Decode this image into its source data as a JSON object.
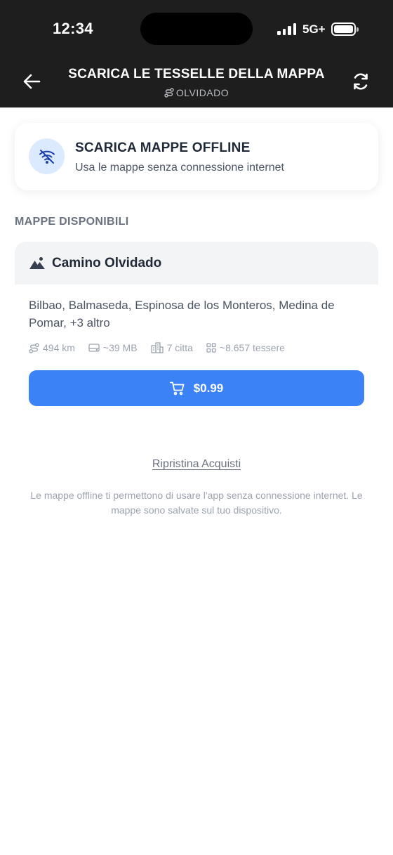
{
  "status_bar": {
    "time": "12:34",
    "network": "5G+",
    "battery_icon": "battery-full-icon",
    "signal_icon": "cellular-signal-icon"
  },
  "header": {
    "title": "SCARICA LE TESSELLE DELLA MAPPA",
    "subtitle": "OLVIDADO",
    "subtitle_icon": "route-icon",
    "back_icon": "arrow-left-icon",
    "refresh_icon": "refresh-icon",
    "background": "#1e1e1e"
  },
  "info_card": {
    "icon": "wifi-off-icon",
    "title": "SCARICA MAPPE OFFLINE",
    "subtitle": "Usa le mappe senza connessione internet"
  },
  "section": {
    "label": "MAPPE DISPONIBILI"
  },
  "map_card": {
    "icon": "mountain-icon",
    "name": "Camino Olvidado",
    "cities": "Bilbao, Balmaseda, Espinosa de los Monteros, Medina de Pomar, +3 altro",
    "stats": [
      {
        "icon": "route-icon",
        "value": "494 km"
      },
      {
        "icon": "storage-icon",
        "value": "~39 MB"
      },
      {
        "icon": "buildings-icon",
        "value": "7 citta"
      },
      {
        "icon": "grid-icon",
        "value": "~8.657 tessere"
      }
    ],
    "buy": {
      "icon": "cart-icon",
      "label": "$0.99",
      "color": "#3b82f6"
    }
  },
  "restore_link": "Ripristina Acquisti",
  "footnote": "Le mappe offline ti permettono di usare l'app senza connessione internet. Le mappe sono salvate sul tuo dispositivo."
}
